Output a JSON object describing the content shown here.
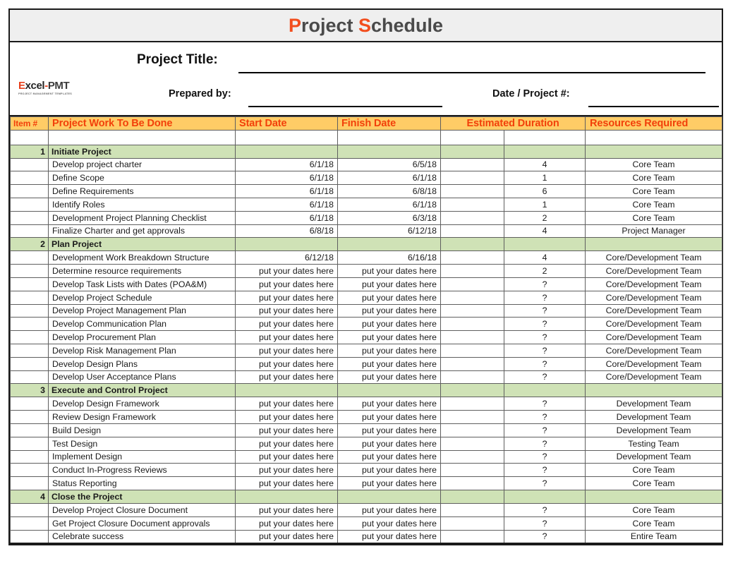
{
  "title": {
    "full": "Project Schedule",
    "word1_cap": "P",
    "word1_rest": "roject",
    "word2_cap": "S",
    "word2_rest": "chedule"
  },
  "logo": {
    "main_e": "E",
    "main_xcel": "xcel",
    "main_dash": "-",
    "main_pmt": "PMT",
    "subtitle": "PROJECT MANAGEMENT TEMPLATES"
  },
  "form": {
    "project_title_label": "Project Title:",
    "project_title_value": "",
    "prepared_by_label": "Prepared by:",
    "prepared_by_value": "",
    "date_project_label": "Date / Project #:",
    "date_project_value": ""
  },
  "columns": {
    "item": "Item #",
    "work": "Project Work To Be Done",
    "start": "Start Date",
    "finish": "Finish Date",
    "duration": "Estimated Duration",
    "resources": "Resources Required"
  },
  "colors": {
    "header_bg": "#ffcc66",
    "header_text": "#f2400a",
    "section_bg": "#cfe2b6",
    "title_accent": "#f24e1e",
    "title_text": "#4a4a4a",
    "banner_bg": "#efefef",
    "grid_line": "#5f5f5f",
    "frame_line": "#1a1a1a"
  },
  "rows": [
    {
      "kind": "blank",
      "num": "",
      "name": "",
      "start": "",
      "finish": "",
      "duration": "",
      "resources": ""
    },
    {
      "kind": "section",
      "num": "1",
      "name": "Initiate Project",
      "start": "",
      "finish": "",
      "duration": "",
      "resources": ""
    },
    {
      "kind": "task",
      "num": "",
      "name": "Develop project charter",
      "start": "6/1/18",
      "finish": "6/5/18",
      "duration": "4",
      "resources": "Core Team"
    },
    {
      "kind": "task",
      "num": "",
      "name": "Define Scope",
      "start": "6/1/18",
      "finish": "6/1/18",
      "duration": "1",
      "resources": "Core Team"
    },
    {
      "kind": "task",
      "num": "",
      "name": "Define Requirements",
      "start": "6/1/18",
      "finish": "6/8/18",
      "duration": "6",
      "resources": "Core Team"
    },
    {
      "kind": "task",
      "num": "",
      "name": "Identify Roles",
      "start": "6/1/18",
      "finish": "6/1/18",
      "duration": "1",
      "resources": "Core Team"
    },
    {
      "kind": "task",
      "num": "",
      "name": "Development Project Planning Checklist",
      "start": "6/1/18",
      "finish": "6/3/18",
      "duration": "2",
      "resources": "Core Team"
    },
    {
      "kind": "task",
      "num": "",
      "name": "Finalize Charter and get approvals",
      "start": "6/8/18",
      "finish": "6/12/18",
      "duration": "4",
      "resources": "Project Manager"
    },
    {
      "kind": "section",
      "num": "2",
      "name": "Plan Project",
      "start": "",
      "finish": "",
      "duration": "",
      "resources": ""
    },
    {
      "kind": "task",
      "num": "",
      "name": "Development Work Breakdown Structure",
      "start": "6/12/18",
      "finish": "6/16/18",
      "duration": "4",
      "resources": "Core/Development Team"
    },
    {
      "kind": "task",
      "num": "",
      "name": "Determine resource requirements",
      "start": "put your dates here",
      "finish": "put your dates here",
      "duration": "2",
      "resources": "Core/Development Team"
    },
    {
      "kind": "task",
      "num": "",
      "name": "Develop Task Lists with Dates (POA&M)",
      "start": "put your dates here",
      "finish": "put your dates here",
      "duration": "?",
      "resources": "Core/Development Team"
    },
    {
      "kind": "task",
      "num": "",
      "name": "Develop Project Schedule",
      "start": "put your dates here",
      "finish": "put your dates here",
      "duration": "?",
      "resources": "Core/Development Team"
    },
    {
      "kind": "task",
      "num": "",
      "name": "Develop Project Management Plan",
      "start": "put your dates here",
      "finish": "put your dates here",
      "duration": "?",
      "resources": "Core/Development Team"
    },
    {
      "kind": "task",
      "num": "",
      "name": "Develop Communication Plan",
      "start": "put your dates here",
      "finish": "put your dates here",
      "duration": "?",
      "resources": "Core/Development Team"
    },
    {
      "kind": "task",
      "num": "",
      "name": "Develop Procurement Plan",
      "start": "put your dates here",
      "finish": "put your dates here",
      "duration": "?",
      "resources": "Core/Development Team"
    },
    {
      "kind": "task",
      "num": "",
      "name": "Develop Risk Management Plan",
      "start": "put your dates here",
      "finish": "put your dates here",
      "duration": "?",
      "resources": "Core/Development Team"
    },
    {
      "kind": "task",
      "num": "",
      "name": "Develop Design Plans",
      "start": "put your dates here",
      "finish": "put your dates here",
      "duration": "?",
      "resources": "Core/Development Team"
    },
    {
      "kind": "task",
      "num": "",
      "name": "Develop User Acceptance Plans",
      "start": "put your dates here",
      "finish": "put your dates here",
      "duration": "?",
      "resources": "Core/Development Team"
    },
    {
      "kind": "section",
      "num": "3",
      "name": "Execute and Control Project",
      "start": "",
      "finish": "",
      "duration": "",
      "resources": ""
    },
    {
      "kind": "task",
      "num": "",
      "name": "Develop Design Framework",
      "start": "put your dates here",
      "finish": "put your dates here",
      "duration": "?",
      "resources": "Development Team"
    },
    {
      "kind": "task",
      "num": "",
      "name": "Review Design Framework",
      "start": "put your dates here",
      "finish": "put your dates here",
      "duration": "?",
      "resources": "Development Team"
    },
    {
      "kind": "task",
      "num": "",
      "name": "Build Design",
      "start": "put your dates here",
      "finish": "put your dates here",
      "duration": "?",
      "resources": "Development Team"
    },
    {
      "kind": "task",
      "num": "",
      "name": "Test Design",
      "start": "put your dates here",
      "finish": "put your dates here",
      "duration": "?",
      "resources": "Testing Team"
    },
    {
      "kind": "task",
      "num": "",
      "name": "Implement Design",
      "start": "put your dates here",
      "finish": "put your dates here",
      "duration": "?",
      "resources": "Development Team"
    },
    {
      "kind": "task",
      "num": "",
      "name": "Conduct In-Progress Reviews",
      "start": "put your dates here",
      "finish": "put your dates here",
      "duration": "?",
      "resources": "Core Team"
    },
    {
      "kind": "task",
      "num": "",
      "name": "Status Reporting",
      "start": "put your dates here",
      "finish": "put your dates here",
      "duration": "?",
      "resources": "Core Team"
    },
    {
      "kind": "section",
      "num": "4",
      "name": "Close the Project",
      "start": "",
      "finish": "",
      "duration": "",
      "resources": ""
    },
    {
      "kind": "task",
      "num": "",
      "name": "Develop Project Closure Document",
      "start": "put your dates here",
      "finish": "put your dates here",
      "duration": "?",
      "resources": "Core Team"
    },
    {
      "kind": "task",
      "num": "",
      "name": "Get Project Closure Document approvals",
      "start": "put your dates here",
      "finish": "put your dates here",
      "duration": "?",
      "resources": "Core Team"
    },
    {
      "kind": "task",
      "num": "",
      "name": "Celebrate success",
      "start": "put your dates here",
      "finish": "put your dates here",
      "duration": "?",
      "resources": "Entire Team"
    }
  ]
}
